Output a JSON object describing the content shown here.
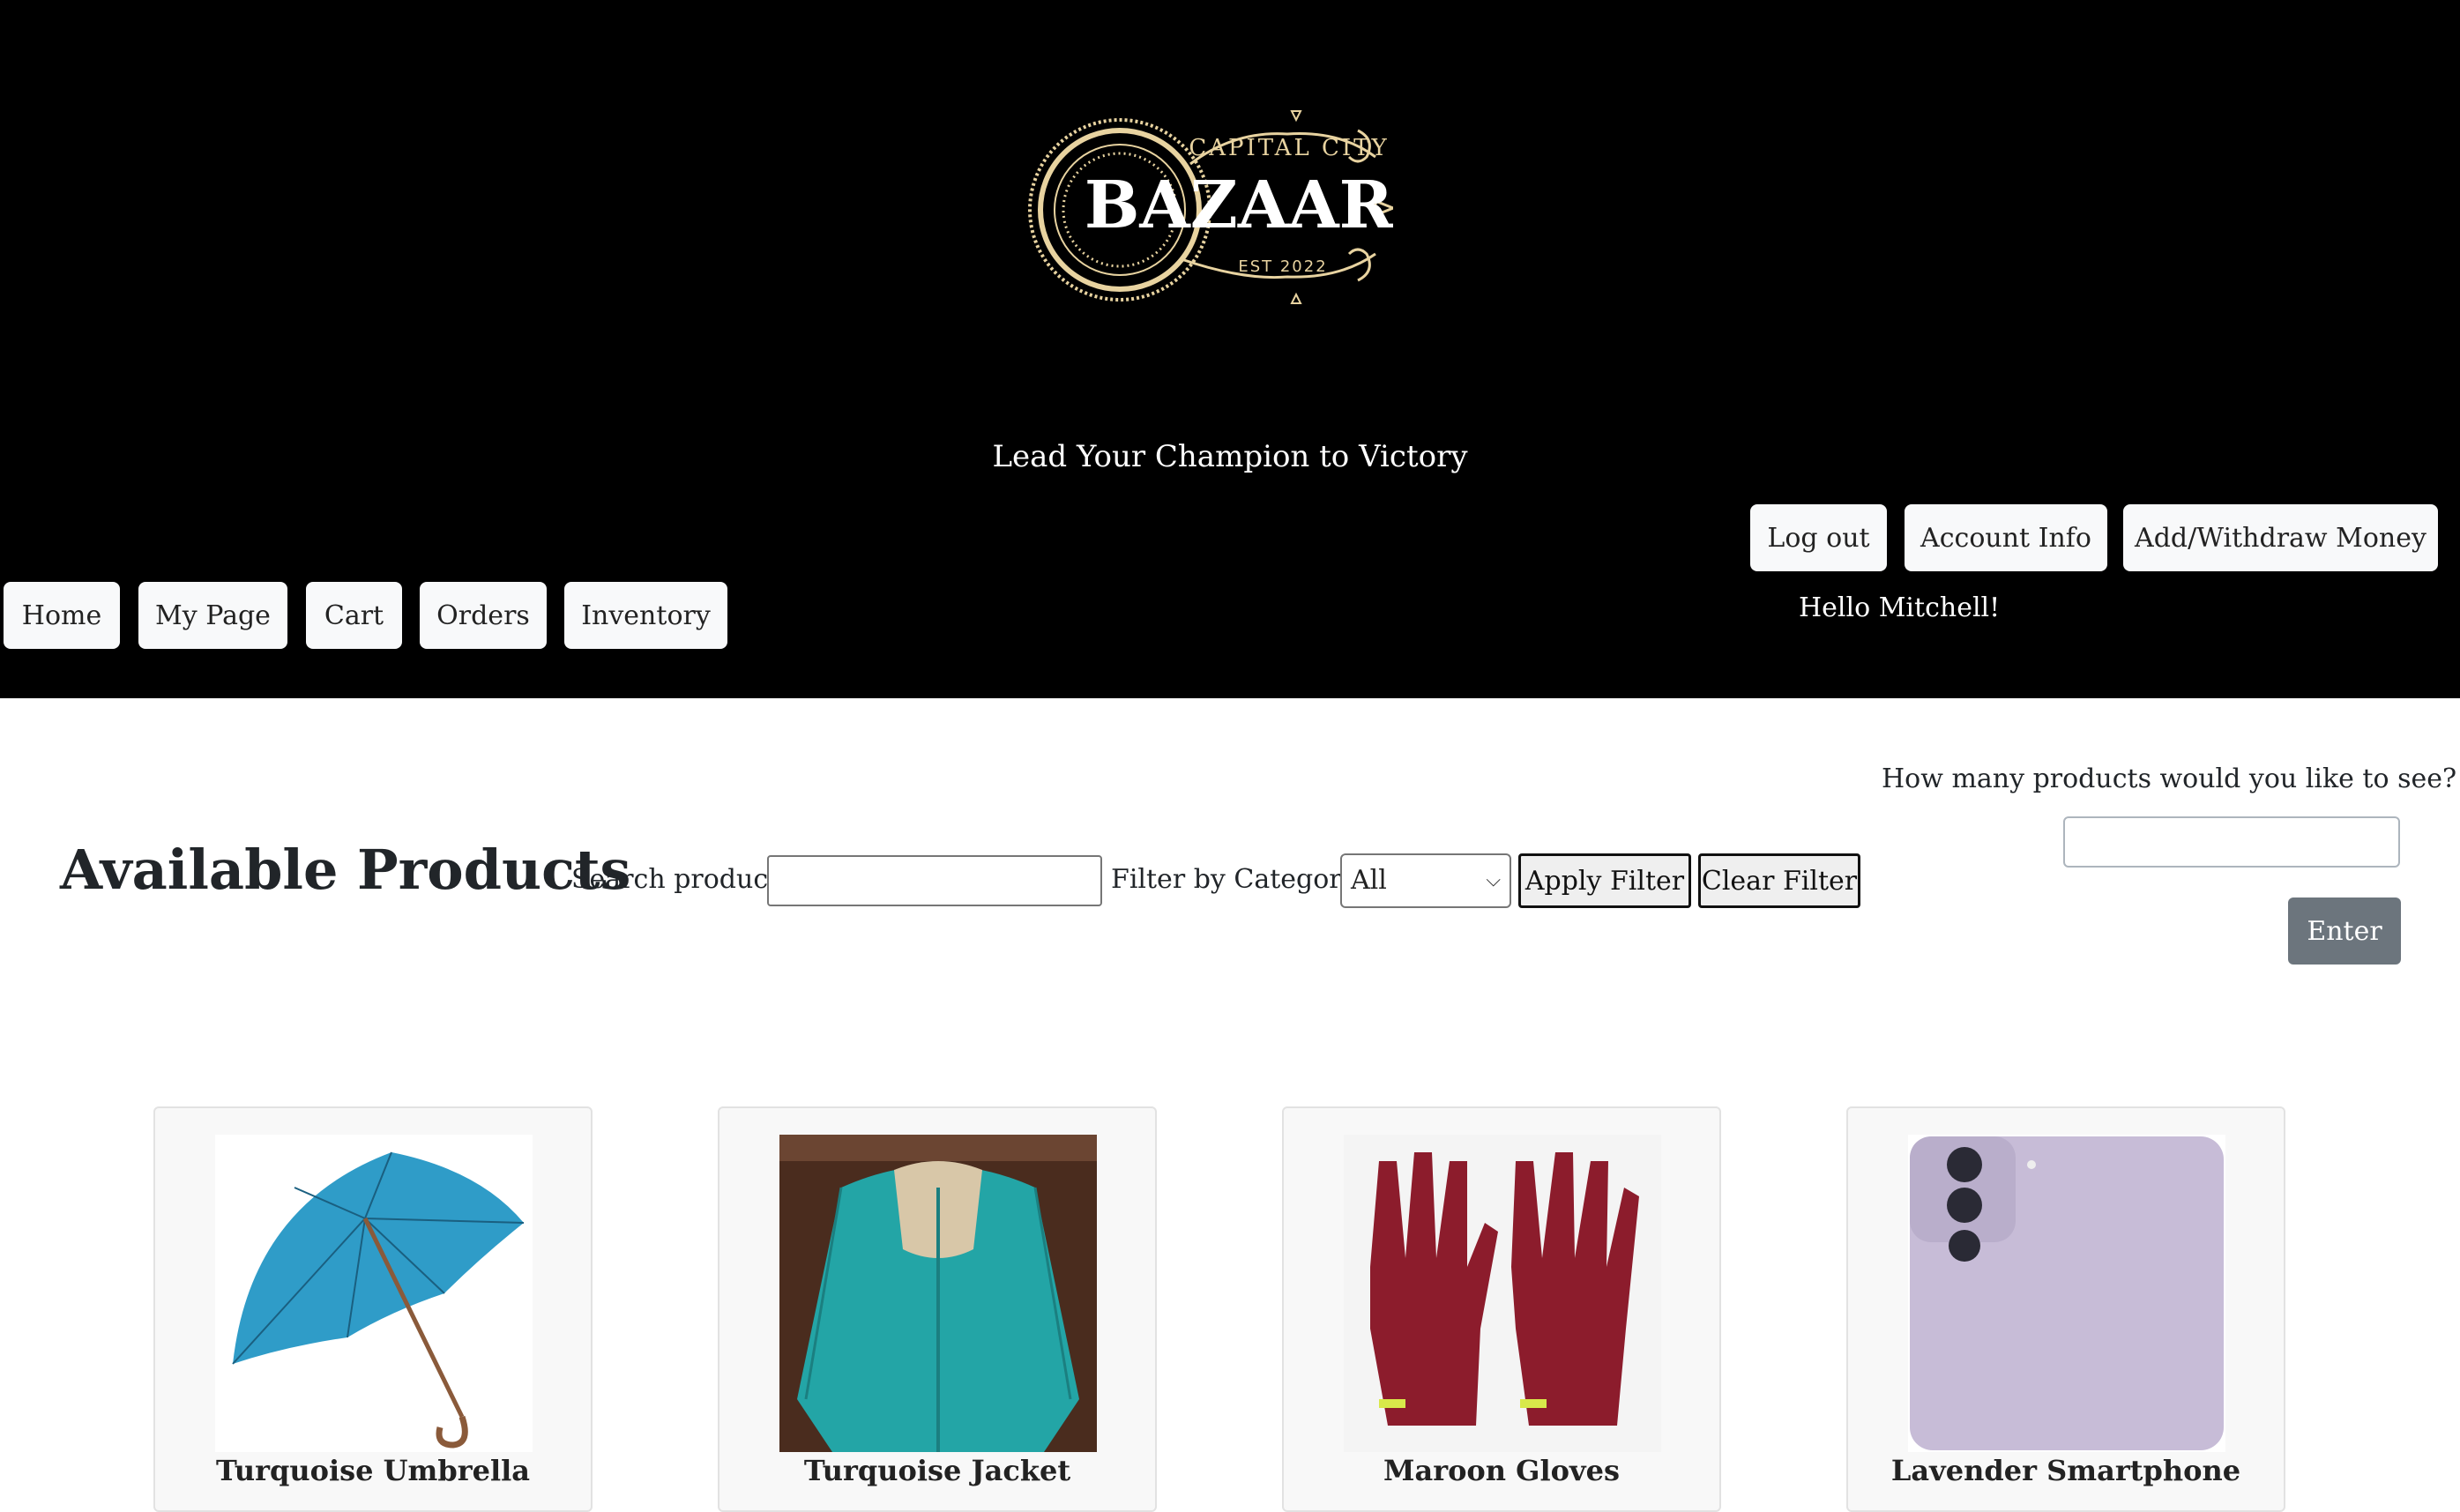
{
  "brand": {
    "logo_top": "CAPITAL CITY",
    "logo_main": "BAZAAR",
    "logo_est": "EST 2022",
    "tagline": "Lead Your Champion to Victory"
  },
  "account_nav": {
    "logout": "Log out",
    "account_info": "Account Info",
    "money": "Add/Withdraw Money",
    "greeting": "Hello Mitchell!"
  },
  "main_nav": {
    "home": "Home",
    "my_page": "My Page",
    "cart": "Cart",
    "orders": "Orders",
    "inventory": "Inventory"
  },
  "products_section": {
    "title": "Available Products",
    "search_label": "Search product:",
    "search_value": "",
    "filter_label": "Filter by Category:",
    "filter_selected": "All",
    "apply_label": "Apply Filter",
    "clear_label": "Clear Filter",
    "count_question": "How many products would you like to see?",
    "count_value": "",
    "enter_label": "Enter"
  },
  "products": [
    {
      "name": "Turquoise Umbrella",
      "image": "umbrella-image"
    },
    {
      "name": "Turquoise Jacket",
      "image": "jacket-image"
    },
    {
      "name": "Maroon Gloves",
      "image": "gloves-image"
    },
    {
      "name": "Lavender Smartphone",
      "image": "smartphone-image"
    }
  ],
  "colors": {
    "header_bg": "#000000",
    "logo_gold": "#e8d3a0",
    "button_bg": "#f8f9fa",
    "enter_bg": "#6c757d",
    "umbrella": "#2f9cc8",
    "jacket": "#23a5a6",
    "gloves": "#8c1c2c",
    "smartphone": "#c7bcd7"
  }
}
